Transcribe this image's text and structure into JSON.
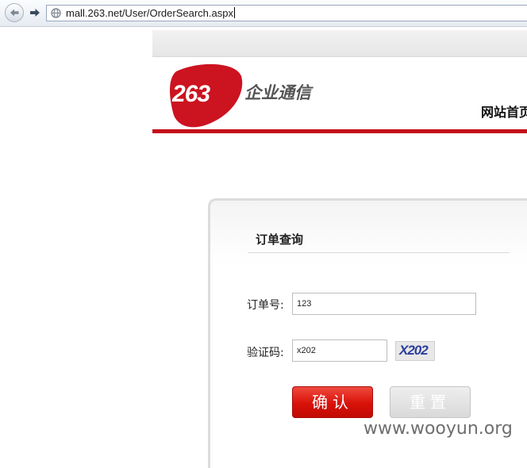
{
  "browser": {
    "url": "mall.263.net/User/OrderSearch.aspx"
  },
  "header": {
    "logo_number": "263",
    "logo_text": "企业通信",
    "home_link": "网站首页"
  },
  "form": {
    "title": "订单查询",
    "order_label": "订单号:",
    "order_value": "123",
    "captcha_label": "验证码:",
    "captcha_value": "x202",
    "captcha_image_text": "X202",
    "confirm_label": "确认",
    "reset_label": "重置"
  },
  "watermark": "www.wooyun.org",
  "colors": {
    "brand_red": "#c40e1a",
    "confirm_red": "#d81209"
  },
  "icons": [
    "back-arrow-icon",
    "forward-arrow-icon",
    "globe-icon"
  ]
}
